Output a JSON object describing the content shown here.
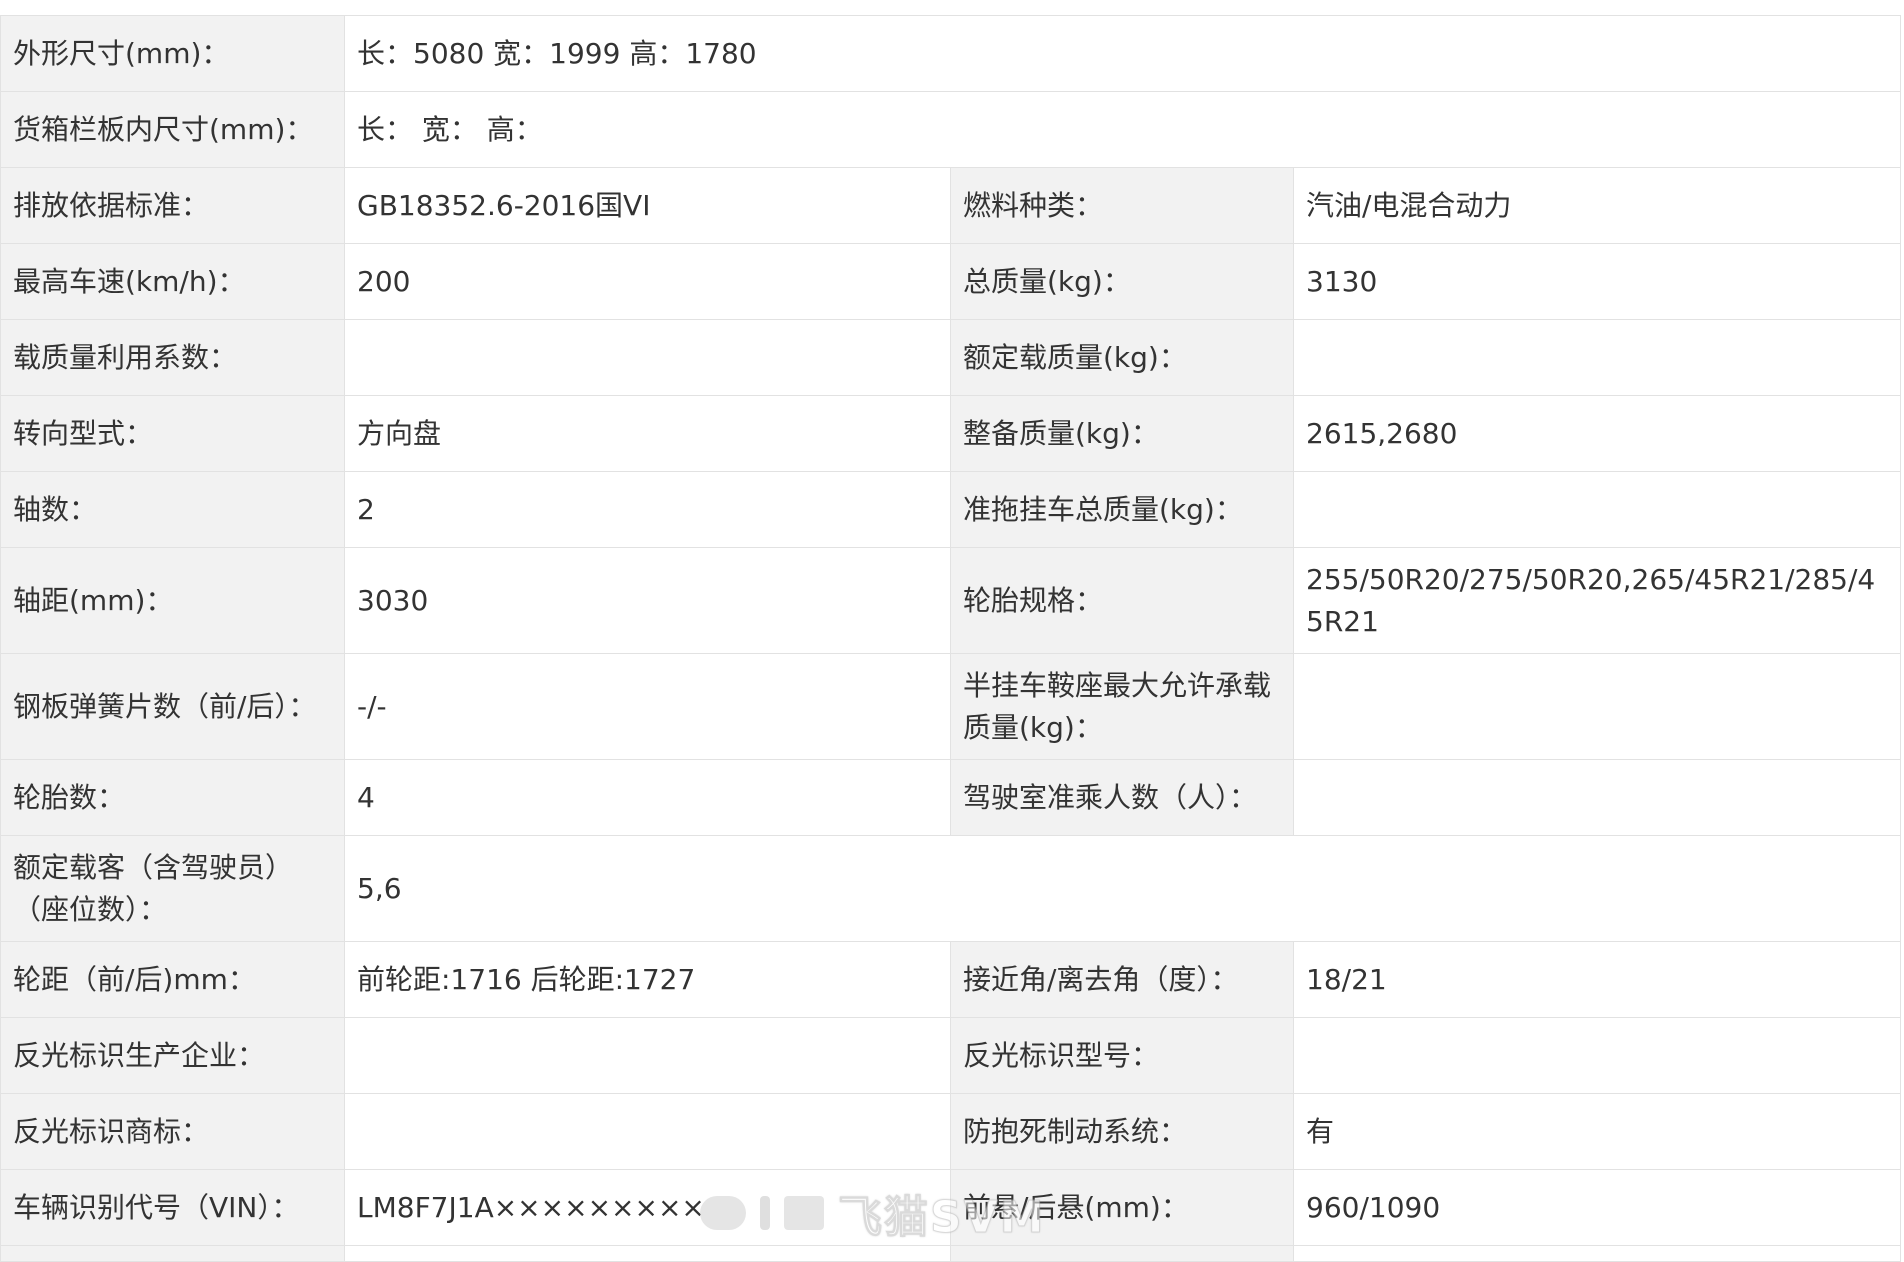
{
  "rows": [
    {
      "l1": "外形尺寸(mm)：",
      "v1": "长：5080 宽：1999 高：1780"
    },
    {
      "l1": "货箱栏板内尺寸(mm)：",
      "v1": "长：  宽：  高："
    },
    {
      "l1": "排放依据标准：",
      "v1": "GB18352.6-2016国VI",
      "l2": "燃料种类：",
      "v2": "汽油/电混合动力"
    },
    {
      "l1": "最高车速(km/h)：",
      "v1": "200",
      "l2": "总质量(kg)：",
      "v2": "3130"
    },
    {
      "l1": "载质量利用系数：",
      "v1": "",
      "l2": "额定载质量(kg)：",
      "v2": ""
    },
    {
      "l1": "转向型式：",
      "v1": "方向盘",
      "l2": "整备质量(kg)：",
      "v2": "2615,2680"
    },
    {
      "l1": "轴数：",
      "v1": "2",
      "l2": "准拖挂车总质量(kg)：",
      "v2": ""
    },
    {
      "l1": "轴距(mm)：",
      "v1": "3030",
      "l2": "轮胎规格：",
      "v2": "255/50R20/275/50R20,265/45R21/285/45R21"
    },
    {
      "l1": "钢板弹簧片数（前/后）：",
      "v1": "-/-",
      "l2": "半挂车鞍座最大允许承载质量(kg)：",
      "v2": ""
    },
    {
      "l1": "轮胎数：",
      "v1": "4",
      "l2": "驾驶室准乘人数（人）：",
      "v2": ""
    },
    {
      "l1": "额定载客（含驾驶员）（座位数）：",
      "v1": "5,6"
    },
    {
      "l1": "轮距（前/后)mm：",
      "v1": "前轮距:1716 后轮距:1727",
      "l2": "接近角/离去角（度）：",
      "v2": "18/21"
    },
    {
      "l1": "反光标识生产企业：",
      "v1": "",
      "l2": "反光标识型号：",
      "v2": ""
    },
    {
      "l1": "反光标识商标：",
      "v1": "",
      "l2": "防抱死制动系统：",
      "v2": "有"
    },
    {
      "l1": "车辆识别代号（VIN）：",
      "v1": "LM8F7J1A×××××××××",
      "l2": "前悬/后悬(mm)：",
      "v2": "960/1090"
    }
  ],
  "watermark": {
    "text": "飞猫SVM"
  }
}
